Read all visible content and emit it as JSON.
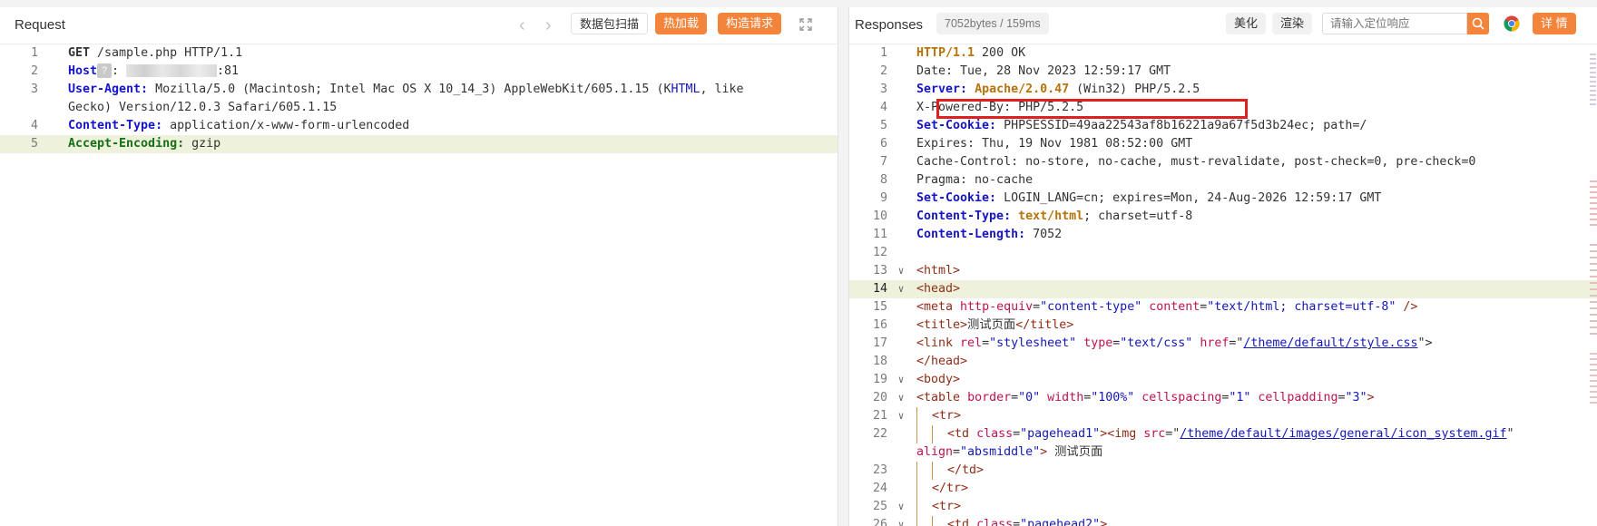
{
  "request": {
    "title": "Request",
    "scan_button": "数据包扫描",
    "hot_load_button": "热加载",
    "build_button": "构造请求",
    "lines": [
      {
        "n": "1",
        "tokens": [
          {
            "t": "GET",
            "c": "k-plain-bold"
          },
          {
            "t": " /sample.php HTTP/1.1"
          }
        ]
      },
      {
        "n": "2",
        "tokens": [
          {
            "t": "Host",
            "c": "k-blue"
          },
          {
            "t": "?",
            "c": "qmark"
          },
          {
            "t": ": "
          },
          {
            "t": "",
            "c": "mask"
          },
          {
            "t": ":81"
          }
        ]
      },
      {
        "n": "3",
        "tokens": [
          {
            "t": "User-Agent:",
            "c": "k-blue"
          },
          {
            "t": " Mozilla/5.0 (Macintosh; Intel Mac OS X 10_14_3) AppleWebKit/605.1.15 (K"
          },
          {
            "t": "HTML",
            "c": "t-str"
          },
          {
            "t": ", like Gecko) Version/12.0.3 Safari/605.1.15"
          }
        ]
      },
      {
        "n": "4",
        "tokens": [
          {
            "t": "Content-Type:",
            "c": "k-blue"
          },
          {
            "t": " application/x-www-form-urlencoded"
          }
        ]
      },
      {
        "n": "5",
        "hl": true,
        "tokens": [
          {
            "t": "Accept-Encoding:",
            "c": "k-green"
          },
          {
            "t": " gzip"
          }
        ]
      }
    ]
  },
  "response": {
    "title": "Responses",
    "size_badge": "7052bytes / 159ms",
    "beautify_button": "美化",
    "render_button": "渲染",
    "search_placeholder": "请输入定位响应",
    "detail_button": "详 情",
    "lines": [
      {
        "n": "1",
        "tokens": [
          {
            "t": "HTTP/1.1",
            "c": "k-orange"
          },
          {
            "t": " 200 OK"
          }
        ]
      },
      {
        "n": "2",
        "tokens": [
          {
            "t": "Date: Tue, 28 Nov 2023 12:59:17 GMT"
          }
        ]
      },
      {
        "n": "3",
        "tokens": [
          {
            "t": "Server:",
            "c": "k-blue"
          },
          {
            "t": " "
          },
          {
            "t": "Apache/2.0.47",
            "c": "k-orange"
          },
          {
            "t": " (Win32) PHP/5.2.5"
          }
        ]
      },
      {
        "n": "4",
        "tokens": [
          {
            "t": "X-Powered-By: PHP/5.2.5"
          }
        ]
      },
      {
        "n": "5",
        "tokens": [
          {
            "t": "Set-Cookie:",
            "c": "k-blue"
          },
          {
            "t": " PHPSESSID=49aa22543af8b16221a9a67f5d3b24ec; path=/"
          }
        ]
      },
      {
        "n": "6",
        "tokens": [
          {
            "t": "Expires: Thu, 19 Nov 1981 08:52:00 GMT"
          }
        ]
      },
      {
        "n": "7",
        "tokens": [
          {
            "t": "Cache-Control: no-store, no-cache, must-revalidate, post-check=0, pre-check=0"
          }
        ]
      },
      {
        "n": "8",
        "tokens": [
          {
            "t": "Pragma: no-cache"
          }
        ]
      },
      {
        "n": "9",
        "tokens": [
          {
            "t": "Set-Cookie:",
            "c": "k-blue"
          },
          {
            "t": " LOGIN_LANG=cn; expires=Mon, 24-Aug-2026 12:59:17 GMT"
          }
        ]
      },
      {
        "n": "10",
        "tokens": [
          {
            "t": "Content-Type:",
            "c": "k-blue"
          },
          {
            "t": " "
          },
          {
            "t": "text/html",
            "c": "k-orange"
          },
          {
            "t": "; charset=utf-8"
          }
        ]
      },
      {
        "n": "11",
        "tokens": [
          {
            "t": "Content-Length:",
            "c": "k-blue"
          },
          {
            "t": " 7052"
          }
        ]
      },
      {
        "n": "12",
        "tokens": []
      },
      {
        "n": "13",
        "fold": true,
        "tokens": [
          {
            "t": "<html>",
            "c": "t-tag"
          }
        ]
      },
      {
        "n": "14",
        "fold": true,
        "hl": true,
        "cur": true,
        "tokens": [
          {
            "t": "<head>",
            "c": "t-tag"
          }
        ]
      },
      {
        "n": "15",
        "tokens": [
          {
            "t": "<meta",
            "c": "t-tag"
          },
          {
            "t": " "
          },
          {
            "t": "http-equiv",
            "c": "t-attr"
          },
          {
            "t": "="
          },
          {
            "t": "\"content-type\"",
            "c": "t-str"
          },
          {
            "t": " "
          },
          {
            "t": "content",
            "c": "t-attr"
          },
          {
            "t": "="
          },
          {
            "t": "\"text/html; charset=utf-8\"",
            "c": "t-str"
          },
          {
            "t": " />",
            "c": "t-tag"
          }
        ]
      },
      {
        "n": "16",
        "tokens": [
          {
            "t": "<title>",
            "c": "t-tag"
          },
          {
            "t": "测试页面"
          },
          {
            "t": "</title>",
            "c": "t-tag"
          }
        ]
      },
      {
        "n": "17",
        "tokens": [
          {
            "t": "<link",
            "c": "t-tag"
          },
          {
            "t": " "
          },
          {
            "t": "rel",
            "c": "t-attr"
          },
          {
            "t": "="
          },
          {
            "t": "\"stylesheet\"",
            "c": "t-str"
          },
          {
            "t": " "
          },
          {
            "t": "type",
            "c": "t-attr"
          },
          {
            "t": "="
          },
          {
            "t": "\"text/css\"",
            "c": "t-str"
          },
          {
            "t": " "
          },
          {
            "t": "href",
            "c": "t-attr"
          },
          {
            "t": "=\""
          },
          {
            "t": "/theme/default/style.css",
            "c": "t-url"
          },
          {
            "t": "\">"
          }
        ]
      },
      {
        "n": "18",
        "tokens": [
          {
            "t": "</head>",
            "c": "t-tag"
          }
        ]
      },
      {
        "n": "19",
        "fold": true,
        "tokens": [
          {
            "t": "<body>",
            "c": "t-tag"
          }
        ]
      },
      {
        "n": "20",
        "fold": true,
        "tokens": [
          {
            "t": "<table",
            "c": "t-tag"
          },
          {
            "t": " "
          },
          {
            "t": "border",
            "c": "t-attr"
          },
          {
            "t": "="
          },
          {
            "t": "\"0\"",
            "c": "t-str"
          },
          {
            "t": " "
          },
          {
            "t": "width",
            "c": "t-attr"
          },
          {
            "t": "="
          },
          {
            "t": "\"100%\"",
            "c": "t-str"
          },
          {
            "t": " "
          },
          {
            "t": "cellspacing",
            "c": "t-attr"
          },
          {
            "t": "="
          },
          {
            "t": "\"1\"",
            "c": "t-str"
          },
          {
            "t": " "
          },
          {
            "t": "cellpadding",
            "c": "t-attr"
          },
          {
            "t": "="
          },
          {
            "t": "\"3\"",
            "c": "t-str"
          },
          {
            "t": ">",
            "c": "t-tag"
          }
        ]
      },
      {
        "n": "21",
        "fold": true,
        "indent": 1,
        "tokens": [
          {
            "t": "<tr>",
            "c": "t-tag"
          }
        ]
      },
      {
        "n": "22",
        "indent": 2,
        "tokens": [
          {
            "t": "<td",
            "c": "t-tag"
          },
          {
            "t": " "
          },
          {
            "t": "class",
            "c": "t-attr"
          },
          {
            "t": "="
          },
          {
            "t": "\"pagehead1\"",
            "c": "t-str"
          },
          {
            "t": "><img",
            "c": "t-tag"
          },
          {
            "t": " "
          },
          {
            "t": "src",
            "c": "t-attr"
          },
          {
            "t": "=\""
          },
          {
            "t": "/theme/default/images/general/icon_system.gif",
            "c": "t-url"
          },
          {
            "t": "\" "
          },
          {
            "t": "align",
            "c": "t-attr"
          },
          {
            "t": "="
          },
          {
            "t": "\"absmiddle\"",
            "c": "t-str"
          },
          {
            "t": ">",
            "c": "t-tag"
          },
          {
            "t": " 测试页面"
          }
        ]
      },
      {
        "n": "23",
        "indent": 2,
        "tokens": [
          {
            "t": "</td>",
            "c": "t-tag"
          }
        ]
      },
      {
        "n": "24",
        "indent": 1,
        "tokens": [
          {
            "t": "</tr>",
            "c": "t-tag"
          }
        ]
      },
      {
        "n": "25",
        "fold": true,
        "indent": 1,
        "tokens": [
          {
            "t": "<tr>",
            "c": "t-tag"
          }
        ]
      },
      {
        "n": "26",
        "fold": true,
        "indent": 2,
        "tokens": [
          {
            "t": "<td",
            "c": "t-tag"
          },
          {
            "t": " "
          },
          {
            "t": "class",
            "c": "t-attr"
          },
          {
            "t": "="
          },
          {
            "t": "\"pagehead2\"",
            "c": "t-str"
          },
          {
            "t": ">",
            "c": "t-tag"
          }
        ]
      }
    ]
  }
}
